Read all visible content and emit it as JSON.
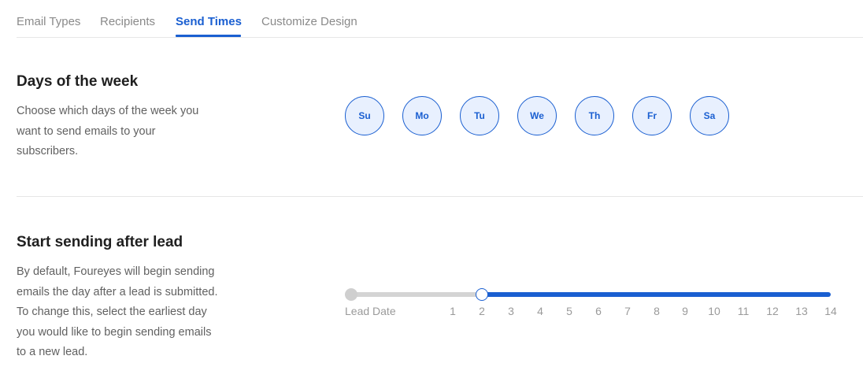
{
  "tabs": [
    {
      "label": "Email Types",
      "active": false
    },
    {
      "label": "Recipients",
      "active": false
    },
    {
      "label": "Send Times",
      "active": true
    },
    {
      "label": "Customize Design",
      "active": false
    }
  ],
  "days_section": {
    "title": "Days of the week",
    "description_lines": [
      "Choose which days of the week you",
      "want to send emails to your",
      "subscribers."
    ],
    "days": [
      {
        "label": "Su",
        "selected": true
      },
      {
        "label": "Mo",
        "selected": true
      },
      {
        "label": "Tu",
        "selected": true
      },
      {
        "label": "We",
        "selected": true
      },
      {
        "label": "Th",
        "selected": true
      },
      {
        "label": "Fr",
        "selected": true
      },
      {
        "label": "Sa",
        "selected": true
      }
    ]
  },
  "lead_section": {
    "title": "Start sending after lead",
    "description_lines": [
      "By default, Foureyes will begin sending",
      "emails the day after a lead is submitted.",
      "To change this, select the earliest day",
      "you would like to begin sending emails",
      "to a new lead."
    ],
    "slider": {
      "tick_labels": [
        "Lead Date",
        "1",
        "2",
        "3",
        "4",
        "5",
        "6",
        "7",
        "8",
        "9",
        "10",
        "11",
        "12",
        "13",
        "14"
      ],
      "selected_value": "2"
    }
  },
  "colors": {
    "accent": "#1a5fd1",
    "day_fill": "#e8f0fe",
    "muted_text": "#9a9a9a"
  }
}
